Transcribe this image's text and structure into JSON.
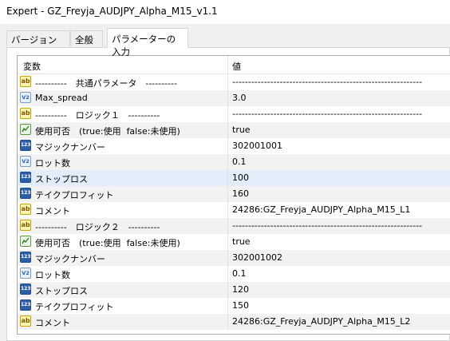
{
  "window": {
    "title": "Expert - GZ_Freyja_AUDJPY_Alpha_M15_v1.1"
  },
  "tabs": [
    {
      "label": "バージョン情報"
    },
    {
      "label": "全般"
    },
    {
      "label": "パラメーターの入力",
      "active": true
    }
  ],
  "grid": {
    "headers": {
      "name": "変数",
      "value": "値"
    },
    "rows": [
      {
        "icon": "ab",
        "name": "----------　共通パラメータ　----------",
        "value": "------------------------------------------------------------"
      },
      {
        "icon": "va",
        "name": "Max_spread",
        "value": "3.0"
      },
      {
        "icon": "ab",
        "name": "----------　ロジック１　----------",
        "value": "------------------------------------------------------------"
      },
      {
        "icon": "bool",
        "name": "使用可否　(true:使用  false:未使用)",
        "value": "true"
      },
      {
        "icon": "123",
        "name": "マジックナンバー",
        "value": "302001001"
      },
      {
        "icon": "va",
        "name": "ロット数",
        "value": "0.1"
      },
      {
        "icon": "123",
        "name": "ストップロス",
        "value": "100"
      },
      {
        "icon": "123",
        "name": "テイクプロフィット",
        "value": "160"
      },
      {
        "icon": "ab",
        "name": "コメント",
        "value": "24286:GZ_Freyja_AUDJPY_Alpha_M15_L1"
      },
      {
        "icon": "ab",
        "name": "----------　ロジック２　----------",
        "value": "------------------------------------------------------------"
      },
      {
        "icon": "bool",
        "name": "使用可否　(true:使用  false:未使用)",
        "value": "true"
      },
      {
        "icon": "123",
        "name": "マジックナンバー",
        "value": "302001002"
      },
      {
        "icon": "va",
        "name": "ロット数",
        "value": "0.1"
      },
      {
        "icon": "123",
        "name": "ストップロス",
        "value": "120"
      },
      {
        "icon": "123",
        "name": "テイクプロフィット",
        "value": "150"
      },
      {
        "icon": "ab",
        "name": "コメント",
        "value": "24286:GZ_Freyja_AUDJPY_Alpha_M15_L2"
      }
    ]
  },
  "icon_labels": {
    "ab": "ab",
    "va": "V2",
    "123": "123"
  }
}
